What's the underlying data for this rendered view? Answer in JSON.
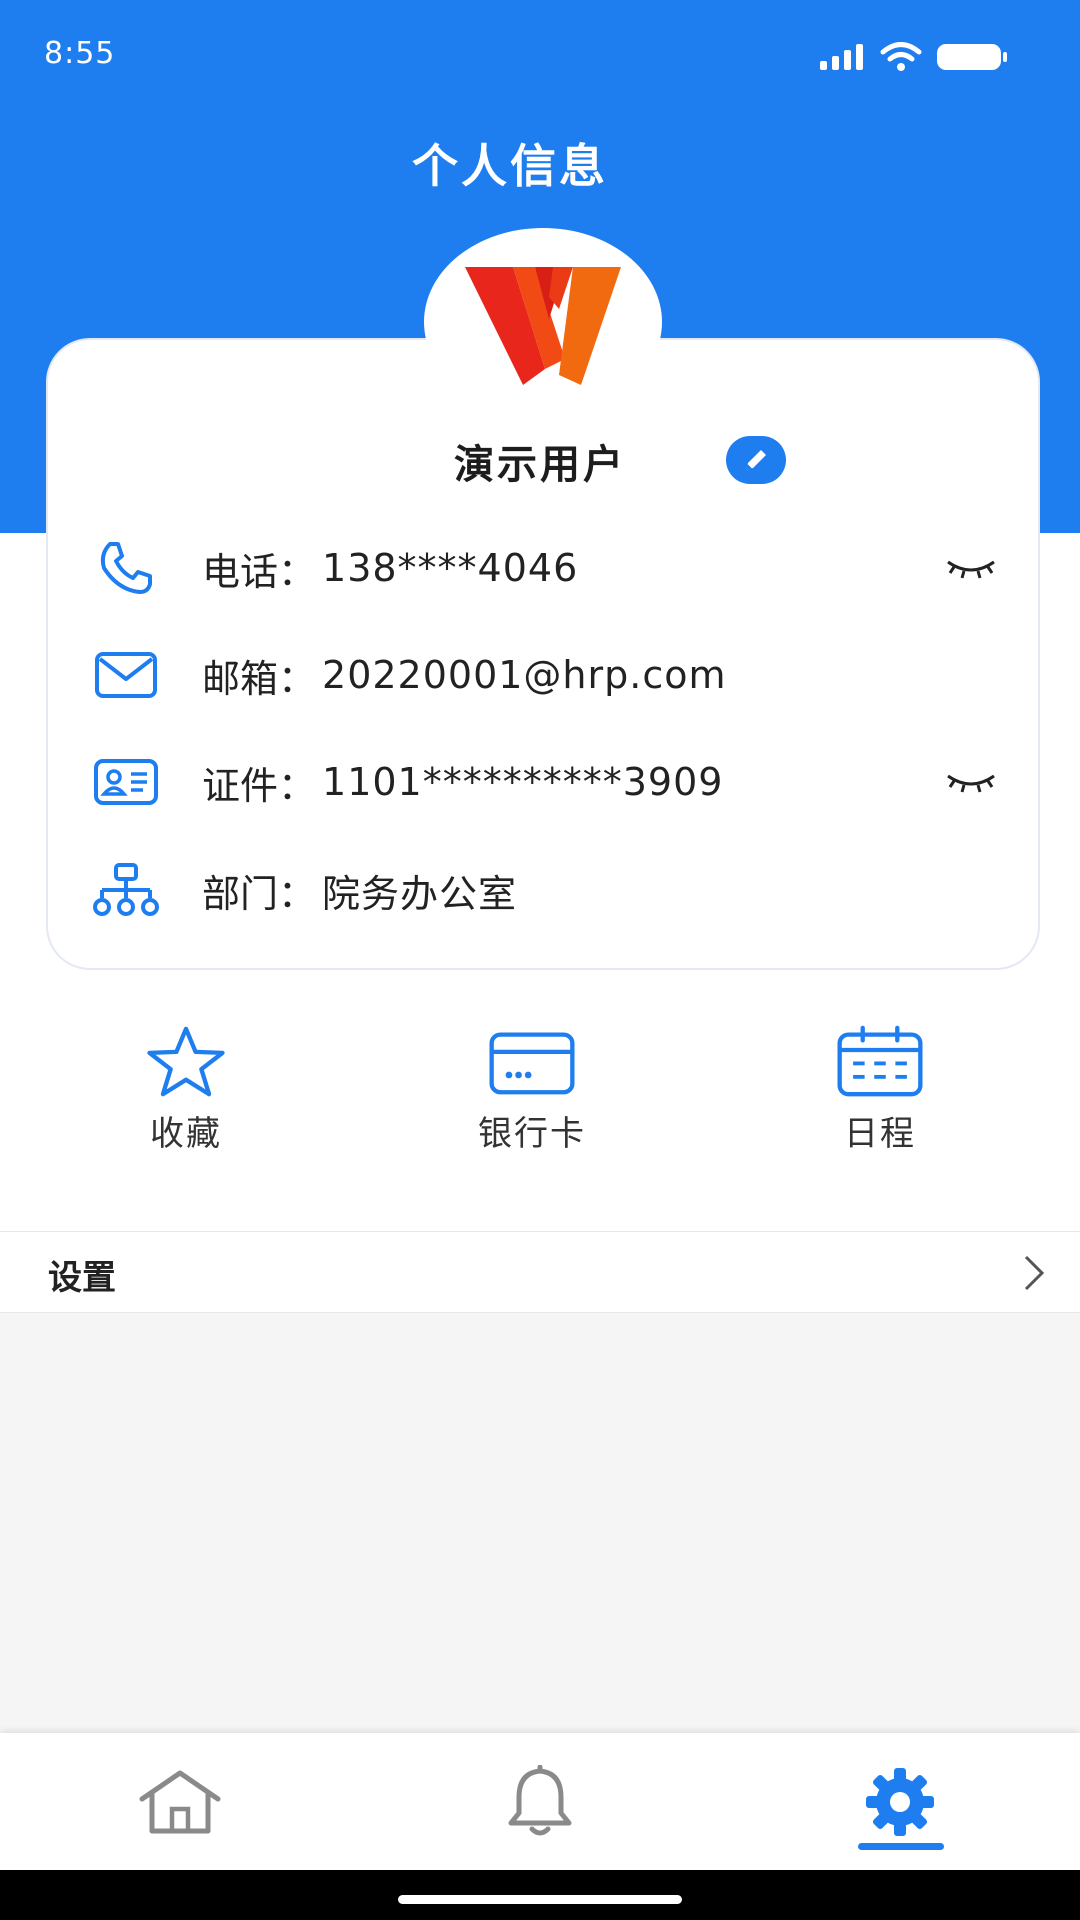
{
  "status_bar": {
    "time": "8:55"
  },
  "header": {
    "title": "个人信息"
  },
  "profile": {
    "name": "演示用户",
    "rows": [
      {
        "icon": "phone-icon",
        "label": "电话：",
        "value": "138****4046",
        "masked": true
      },
      {
        "icon": "mail-icon",
        "label": "邮箱：",
        "value": "20220001@hrp.com",
        "masked": false
      },
      {
        "icon": "id-card-icon",
        "label": "证件：",
        "value": "1101**********3909",
        "masked": true
      },
      {
        "icon": "org-chart-icon",
        "label": "部门：",
        "value": "院务办公室",
        "masked": false
      }
    ]
  },
  "quick_actions": [
    {
      "icon": "star-icon",
      "label": "收藏"
    },
    {
      "icon": "bank-card-icon",
      "label": "银行卡"
    },
    {
      "icon": "calendar-icon",
      "label": "日程"
    }
  ],
  "settings": {
    "label": "设置"
  },
  "tabbar": {
    "tabs": [
      {
        "icon": "home-icon",
        "active": false
      },
      {
        "icon": "bell-icon",
        "active": false
      },
      {
        "icon": "gear-icon",
        "active": true
      }
    ]
  },
  "colors": {
    "primary": "#1e7ef0",
    "inactive": "#8a8a8a",
    "text": "#222222"
  }
}
